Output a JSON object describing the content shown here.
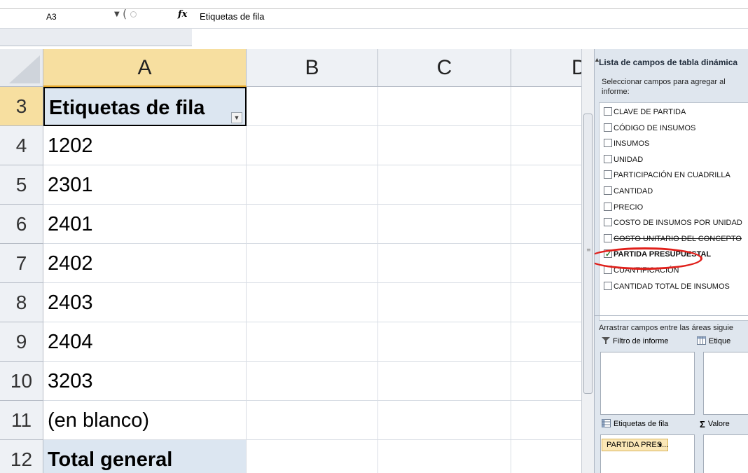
{
  "formula_bar": {
    "name_box": "A3",
    "fx_label": "fx",
    "content": "Etiquetas de fila"
  },
  "grid": {
    "columns": [
      "A",
      "B",
      "C",
      "D"
    ],
    "rows": [
      {
        "num": "3",
        "value": "Etiquetas de fila"
      },
      {
        "num": "4",
        "value": "1202"
      },
      {
        "num": "5",
        "value": "2301"
      },
      {
        "num": "6",
        "value": "2401"
      },
      {
        "num": "7",
        "value": "2402"
      },
      {
        "num": "8",
        "value": "2403"
      },
      {
        "num": "9",
        "value": "2404"
      },
      {
        "num": "10",
        "value": "3203"
      },
      {
        "num": "11",
        "value": "(en blanco)"
      },
      {
        "num": "12",
        "value": "Total general"
      }
    ]
  },
  "pivot_panel": {
    "title": "Lista de campos de tabla dinámica",
    "instruction": "Seleccionar campos para agregar al informe:",
    "fields": [
      {
        "label": "CLAVE DE PARTIDA",
        "checked": false
      },
      {
        "label": "CÓDIGO DE INSUMOS",
        "checked": false
      },
      {
        "label": "INSUMOS",
        "checked": false
      },
      {
        "label": "UNIDAD",
        "checked": false
      },
      {
        "label": "PARTICIPACIÓN EN CUADRILLA",
        "checked": false
      },
      {
        "label": "CANTIDAD",
        "checked": false
      },
      {
        "label": "PRECIO",
        "checked": false
      },
      {
        "label": "COSTO DE INSUMOS POR UNIDAD",
        "checked": false
      },
      {
        "label": "COSTO UNITARIO DEL CONCEPTO",
        "checked": false
      },
      {
        "label": "PARTIDA PRESUPUESTAL",
        "checked": true
      },
      {
        "label": "CUANTIFICACIÓN",
        "checked": false
      },
      {
        "label": "CANTIDAD TOTAL DE INSUMOS",
        "checked": false
      }
    ],
    "drag_instruction": "Arrastrar campos entre las áreas siguie",
    "report_filter": "Filtro de informe",
    "column_labels": "Etique",
    "row_labels": "Etiquetas de fila",
    "values": "Valore",
    "row_field_pill": "PARTIDA PRES..."
  },
  "colors": {
    "header_bg": "#eef1f5",
    "selected_header": "#f7dfa0",
    "pivot_highlight": "#dce6f1",
    "annotation_red": "#e0201b"
  }
}
